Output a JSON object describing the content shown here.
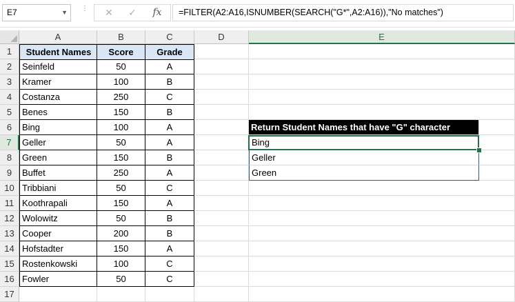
{
  "name_box": "E7",
  "formula": "=FILTER(A2:A16,ISNUMBER(SEARCH(\"G*\",A2:A16)),\"No matches\")",
  "formula_buttons": {
    "cancel": "✕",
    "enter": "✓",
    "fx": "fx"
  },
  "columns": [
    "A",
    "B",
    "C",
    "D",
    "E"
  ],
  "rows": [
    "1",
    "2",
    "3",
    "4",
    "5",
    "6",
    "7",
    "8",
    "9",
    "10",
    "11",
    "12",
    "13",
    "14",
    "15",
    "16",
    "17"
  ],
  "table_headers": [
    "Student Names",
    "Score",
    "Grade"
  ],
  "students": [
    {
      "name": "Seinfeld",
      "score": "50",
      "grade": "A"
    },
    {
      "name": "Kramer",
      "score": "100",
      "grade": "B"
    },
    {
      "name": "Costanza",
      "score": "250",
      "grade": "C"
    },
    {
      "name": "Benes",
      "score": "150",
      "grade": "B"
    },
    {
      "name": "Bing",
      "score": "100",
      "grade": "A"
    },
    {
      "name": "Geller",
      "score": "50",
      "grade": "A"
    },
    {
      "name": "Green",
      "score": "150",
      "grade": "B"
    },
    {
      "name": "Buffet",
      "score": "250",
      "grade": "A"
    },
    {
      "name": "Tribbiani",
      "score": "50",
      "grade": "C"
    },
    {
      "name": "Koothrapali",
      "score": "150",
      "grade": "A"
    },
    {
      "name": "Wolowitz",
      "score": "50",
      "grade": "B"
    },
    {
      "name": "Cooper",
      "score": "200",
      "grade": "B"
    },
    {
      "name": "Hofstadter",
      "score": "150",
      "grade": "A"
    },
    {
      "name": "Rostenkowski",
      "score": "100",
      "grade": "C"
    },
    {
      "name": "Fowler",
      "score": "50",
      "grade": "C"
    }
  ],
  "result_header": "Return Student Names that have \"G\" character",
  "results": [
    "Bing",
    "Geller",
    "Green"
  ],
  "colors": {
    "accent": "#217346",
    "header_fill": "#d9e7f5",
    "result_header_fill": "#000000"
  }
}
